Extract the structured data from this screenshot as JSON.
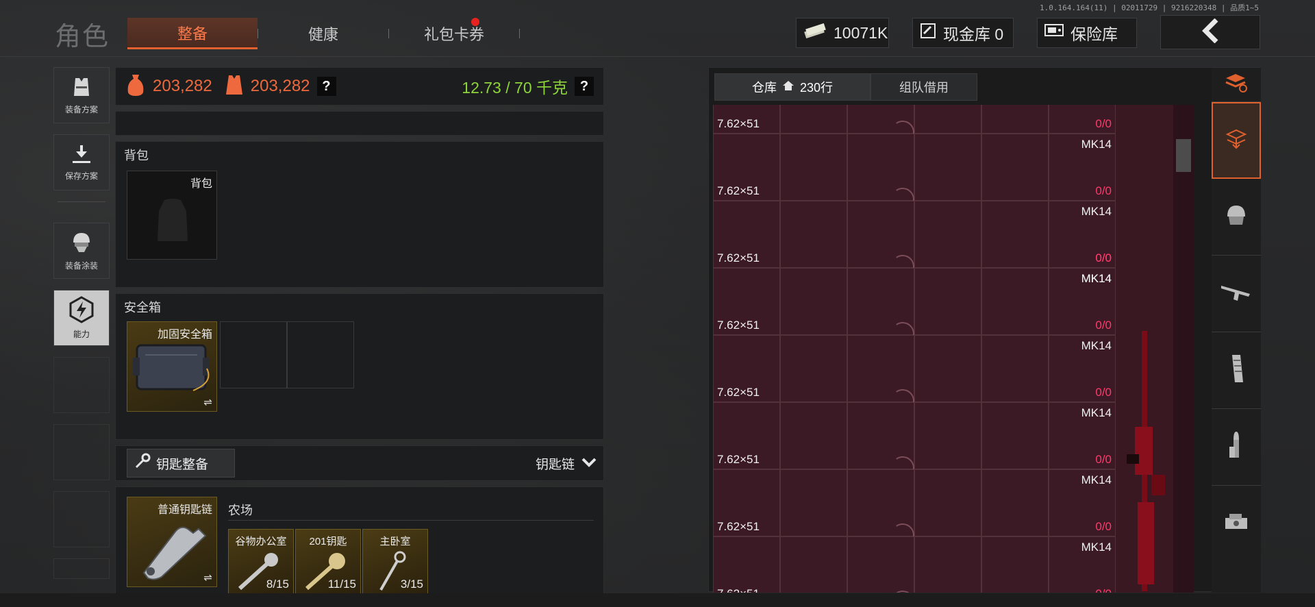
{
  "version": "1.0.164.164(11) | 02011729 | 9216220348 | 品质1~5",
  "page_title": "角色",
  "tabs": [
    {
      "label": "整备",
      "active": true
    },
    {
      "label": "健康",
      "active": false
    },
    {
      "label": "礼包卡券",
      "active": false,
      "badge": true
    }
  ],
  "currency": {
    "money": "10071K",
    "cash_vault": "现金库 0",
    "safe_vault": "保险库"
  },
  "side_nav": [
    {
      "label": "装备方案",
      "icon": "vest-icon"
    },
    {
      "label": "保存方案",
      "icon": "save-download-icon"
    },
    {
      "label": "装备涂装",
      "icon": "helmet-skin-icon"
    },
    {
      "label": "能力",
      "icon": "ability-icon"
    }
  ],
  "stats": {
    "value_1": "203,282",
    "value_2": "203,282",
    "help": "?",
    "weight": "12.73 / 70 千克",
    "weight_help": "?"
  },
  "backpack": {
    "section": "背包",
    "slot_label": "背包"
  },
  "safebox": {
    "section": "安全箱",
    "item": "加固安全箱"
  },
  "keys": {
    "button": "钥匙整备",
    "dropdown": "钥匙链",
    "chain_label": "普通钥匙链",
    "location": "农场",
    "items": [
      {
        "name": "谷物办公室",
        "count": "8/15"
      },
      {
        "name": "201钥匙",
        "count": "11/15"
      },
      {
        "name": "主卧室",
        "count": "3/15"
      }
    ]
  },
  "warehouse": {
    "tab_storage": "仓库",
    "rows": "230行",
    "tab_team": "组队借用",
    "ammo_label": "7.62×51",
    "weapon_label": "MK14",
    "count_left": "0",
    "count_right": "/0"
  },
  "colors": {
    "accent": "#e0602e",
    "orange_value": "#ee6a3e",
    "weight_green": "#8ed43a",
    "grid_bg": "#3c1a25",
    "count_red": "#ff3a6a"
  }
}
